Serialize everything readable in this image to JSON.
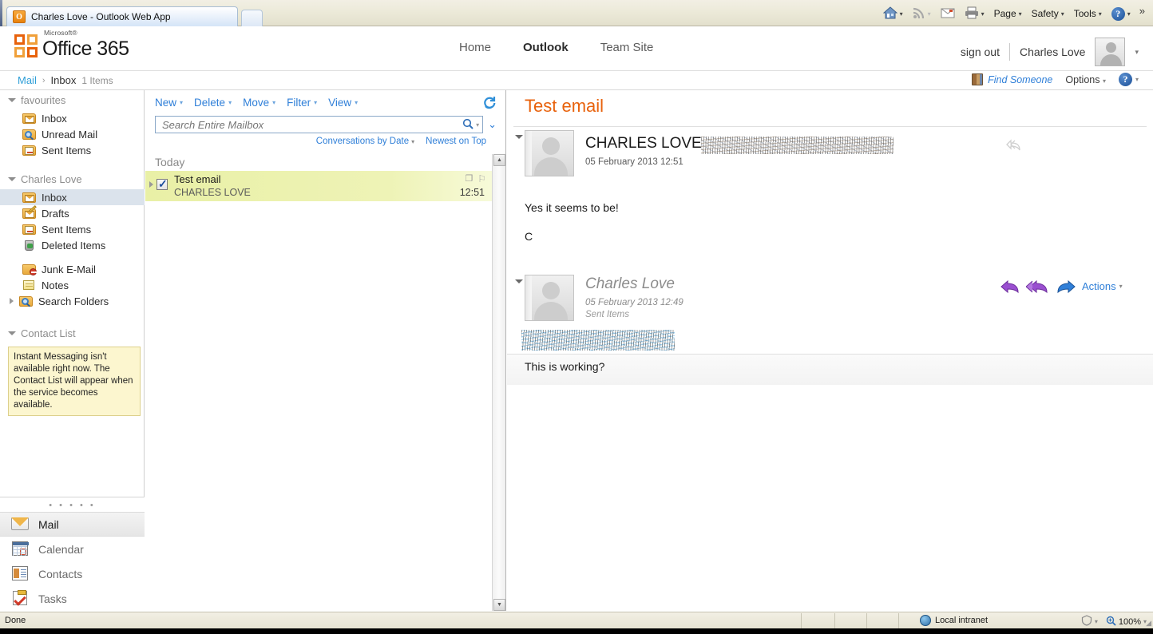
{
  "browser": {
    "tab_title": "Charles Love - Outlook Web App",
    "favicon": "outlook-o-icon",
    "new_tab_label": "",
    "toolbar": [
      {
        "name": "home-icon",
        "label": "",
        "glyph": "⌂"
      },
      {
        "name": "feeds-icon",
        "label": "",
        "glyph": "◉"
      },
      {
        "name": "read-mail-icon",
        "label": "",
        "glyph": "✉"
      },
      {
        "name": "print-icon",
        "label": "",
        "glyph": "⎙"
      },
      {
        "name": "page-menu",
        "label": "Page",
        "glyph": ""
      },
      {
        "name": "safety-menu",
        "label": "Safety",
        "glyph": ""
      },
      {
        "name": "tools-menu",
        "label": "Tools",
        "glyph": ""
      },
      {
        "name": "help-menu",
        "label": "",
        "glyph": "?"
      }
    ],
    "overflow_label": "»"
  },
  "header": {
    "brand_microsoft": "Microsoft®",
    "brand_product": "Office 365",
    "nav": [
      {
        "label": "Home",
        "active": false
      },
      {
        "label": "Outlook",
        "active": true
      },
      {
        "label": "Team Site",
        "active": false
      }
    ],
    "sign_out": "sign out",
    "account_name": "Charles Love",
    "accent_color": "#e8620c"
  },
  "subheader": {
    "breadcrumb_root": "Mail",
    "breadcrumb_sep": "›",
    "breadcrumb_folder": "Inbox",
    "item_count": "1 Items",
    "find_someone": "Find Someone",
    "options": "Options",
    "help": "?"
  },
  "nav_pane": {
    "favourites_group": "favourites",
    "favourites": [
      {
        "label": "Inbox",
        "icon": "folder-mail-icon"
      },
      {
        "label": "Unread Mail",
        "icon": "folder-search-icon"
      },
      {
        "label": "Sent Items",
        "icon": "folder-sent-icon"
      }
    ],
    "mailbox_group": "Charles Love",
    "folders": [
      {
        "label": "Inbox",
        "icon": "folder-mail-icon",
        "selected": true
      },
      {
        "label": "Drafts",
        "icon": "folder-draft-icon",
        "selected": false
      },
      {
        "label": "Sent Items",
        "icon": "folder-sent-icon",
        "selected": false
      },
      {
        "label": "Deleted Items",
        "icon": "folder-trash-icon",
        "selected": false
      },
      {
        "label": "Junk E-Mail",
        "icon": "folder-junk-icon",
        "selected": false
      },
      {
        "label": "Notes",
        "icon": "folder-notes-icon",
        "selected": false
      },
      {
        "label": "Search Folders",
        "icon": "folder-search-icon",
        "selected": false
      }
    ],
    "contact_list_group": "Contact List",
    "im_notice": "Instant Messaging isn't available right now. The Contact List will appear when the service becomes available.",
    "modules": [
      {
        "label": "Mail",
        "icon": "mail-module-icon",
        "active": true
      },
      {
        "label": "Calendar",
        "icon": "calendar-module-icon",
        "active": false
      },
      {
        "label": "Contacts",
        "icon": "contacts-module-icon",
        "active": false
      },
      {
        "label": "Tasks",
        "icon": "tasks-module-icon",
        "active": false
      }
    ]
  },
  "list_pane": {
    "commands": [
      {
        "label": "New",
        "has_caret": true
      },
      {
        "label": "Delete",
        "has_caret": true
      },
      {
        "label": "Move",
        "has_caret": true
      },
      {
        "label": "Filter",
        "has_caret": true
      },
      {
        "label": "View",
        "has_caret": true
      }
    ],
    "refresh_icon": "refresh-icon",
    "search_placeholder": "Search Entire Mailbox",
    "search_value": "",
    "sort_primary": "Conversations by Date",
    "sort_secondary": "Newest on Top",
    "group_header": "Today",
    "messages": [
      {
        "subject": "Test email",
        "sender": "CHARLES LOVE",
        "time": "12:51",
        "selected": true,
        "checked": true,
        "has_attachment": false,
        "flagged": true
      }
    ]
  },
  "reading_pane": {
    "subject": "Test email",
    "messages": [
      {
        "from": "CHARLES LOVE",
        "from_style": "caps",
        "address_redacted": true,
        "date": "05 February 2013 12:51",
        "folder": "",
        "body_lines": [
          "Yes it seems to be!",
          "C"
        ],
        "actions": [
          {
            "name": "reply-all-icon",
            "state": "disabled"
          }
        ]
      },
      {
        "from": "Charles Love",
        "from_style": "italic",
        "address_redacted": true,
        "date": "05 February 2013 12:49",
        "folder": "Sent Items",
        "body_lines": [
          "This is working?"
        ],
        "actions": [
          {
            "name": "reply-icon",
            "state": "enabled"
          },
          {
            "name": "reply-all-icon",
            "state": "enabled"
          },
          {
            "name": "forward-icon",
            "state": "enabled"
          }
        ],
        "actions_menu": "Actions"
      }
    ]
  },
  "status_bar": {
    "status_text": "Done",
    "zone": "Local intranet",
    "protected_mode_icon": "protected-mode-icon",
    "zoom_level": "100%"
  }
}
